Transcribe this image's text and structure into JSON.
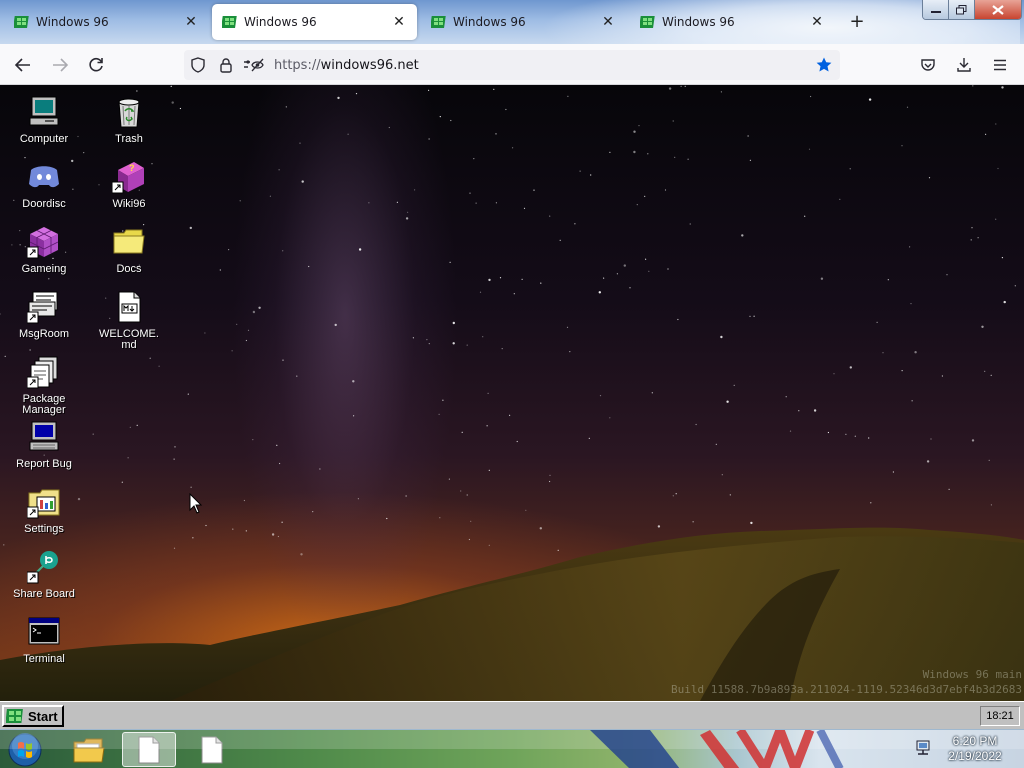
{
  "browser": {
    "tabs": [
      {
        "title": "Windows 96",
        "active": false
      },
      {
        "title": "Windows 96",
        "active": true
      },
      {
        "title": "Windows 96",
        "active": false
      },
      {
        "title": "Windows 96",
        "active": false
      }
    ],
    "close_glyph": "✕",
    "new_tab_glyph": "+",
    "url_scheme": "https://",
    "url_host": "windows96.net",
    "bookmark_color": "#0061e0",
    "icons": [
      "back-icon",
      "forward-icon",
      "reload-icon",
      "shield-icon",
      "lock-icon",
      "permissions-icon",
      "star-icon",
      "pocket-icon",
      "downloads-icon",
      "menu-icon"
    ]
  },
  "desktop": {
    "icons": [
      {
        "label": "Computer",
        "icon": "computer-icon"
      },
      {
        "label": "Doordisc",
        "icon": "discord-icon"
      },
      {
        "label": "Gameing",
        "icon": "cube-icon"
      },
      {
        "label": "MsgRoom",
        "icon": "msgroom-icon"
      },
      {
        "label": "Package Manager",
        "icon": "package-icon"
      },
      {
        "label": "Report Bug",
        "icon": "report-bug-icon"
      },
      {
        "label": "Settings",
        "icon": "settings-icon"
      },
      {
        "label": "Share Board",
        "icon": "share-board-icon"
      },
      {
        "label": "Terminal",
        "icon": "terminal-icon"
      },
      {
        "label": "Trash",
        "icon": "trash-icon"
      },
      {
        "label": "Wiki96",
        "icon": "wiki-book-icon"
      },
      {
        "label": "Docs",
        "icon": "folder-icon"
      },
      {
        "label": "WELCOME.md",
        "icon": "markdown-file-icon"
      }
    ],
    "watermark_line1": "Windows 96 main",
    "watermark_line2": "Build 11588.7b9a893a.211024-1119.52346d3d7ebf4b3d2683"
  },
  "w96_taskbar": {
    "start_label": "Start",
    "clock": "18:21"
  },
  "host_taskbar": {
    "time": "6:20 PM",
    "date": "2/19/2022",
    "buttons": [
      "windows-orb-icon",
      "file-explorer-icon",
      "document-icon",
      "document-icon"
    ]
  }
}
